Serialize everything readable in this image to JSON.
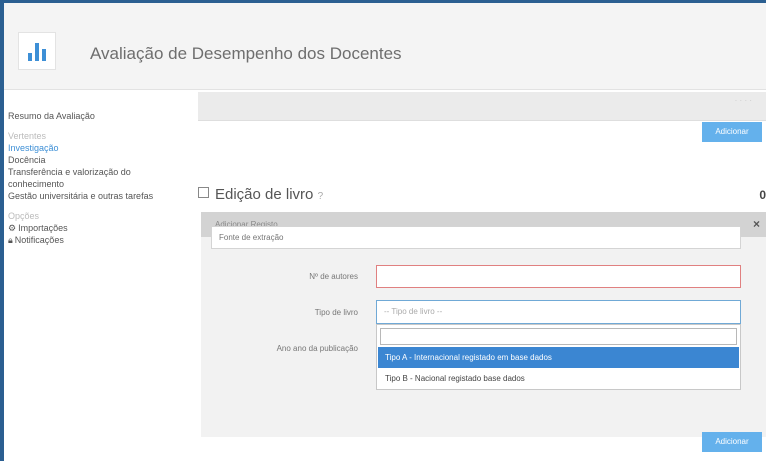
{
  "app": {
    "title": "Avaliação de Desempenho dos Docentes"
  },
  "sidebar": {
    "summary": "Resumo da Avaliação",
    "section_vertentes": "Vertentes",
    "items": [
      {
        "label": "Investigação",
        "active": true
      },
      {
        "label": "Docência",
        "active": false
      },
      {
        "label": "Transferência e valorização do conhecimento",
        "active": false
      },
      {
        "label": "Gestão universitária e outras tarefas",
        "active": false
      }
    ],
    "section_opcoes": "Opções",
    "options": [
      {
        "label": "Importações",
        "icon": "gear-icon"
      },
      {
        "label": "Notificações",
        "icon": "lock-icon"
      }
    ]
  },
  "main": {
    "add_button": "Adicionar",
    "section_title": "Edição de livro",
    "section_help": "?",
    "section_right": "0",
    "panel": {
      "header": "Adicionar Registo",
      "close": "×",
      "search_placeholder": "Fonte de extração",
      "fields": {
        "authors_label": "Nº de autores",
        "authors_value": "",
        "type_label": "Tipo de livro",
        "type_placeholder": "-- Tipo de livro --",
        "year_label": "Ano ano da publicação"
      },
      "dropdown_options": [
        {
          "label": "Tipo A - Internacional registado em base dados",
          "highlighted": true
        },
        {
          "label": "Tipo B - Nacional registado base dados",
          "highlighted": false
        }
      ]
    },
    "save_button": "Adicionar"
  },
  "colors": {
    "brand_blue": "#3d8fd6",
    "frame_blue": "#2b5f91",
    "button_blue": "#64b1ec",
    "highlight": "#3b86d2"
  }
}
